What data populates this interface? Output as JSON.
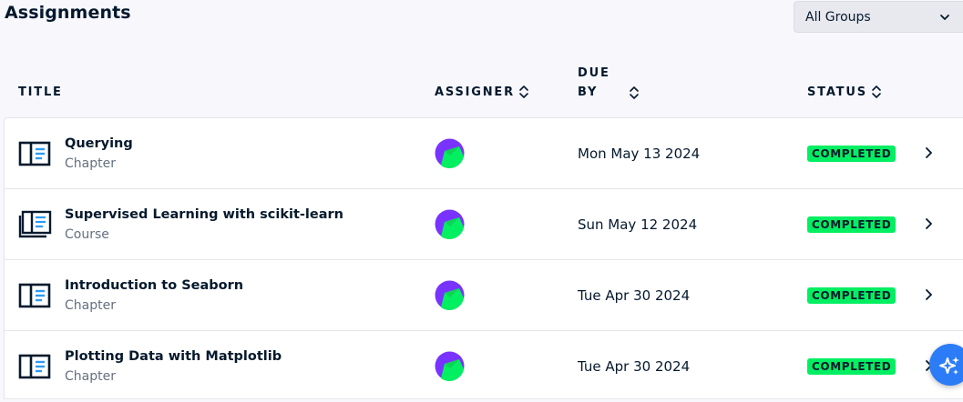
{
  "header": {
    "title": "Assignments",
    "group_filter": "All Groups"
  },
  "columns": {
    "title": "TITLE",
    "assigner": "ASSIGNER",
    "due_line1": "DUE",
    "due_line2": "BY",
    "status": "STATUS"
  },
  "rows": [
    {
      "title": "Querying",
      "type": "Chapter",
      "due": "Mon May 13 2024",
      "status": "COMPLETED",
      "icon": "chapter-icon"
    },
    {
      "title": "Supervised Learning with scikit-learn",
      "type": "Course",
      "due": "Sun May 12 2024",
      "status": "COMPLETED",
      "icon": "course-icon"
    },
    {
      "title": "Introduction to Seaborn",
      "type": "Chapter",
      "due": "Tue Apr 30 2024",
      "status": "COMPLETED",
      "icon": "chapter-icon"
    },
    {
      "title": "Plotting Data with Matplotlib",
      "type": "Chapter",
      "due": "Tue Apr 30 2024",
      "status": "COMPLETED",
      "icon": "chapter-icon"
    }
  ],
  "colors": {
    "status_badge": "#03ef62",
    "avatar_purple": "#7933ff",
    "avatar_green": "#03ef62",
    "ai_button": "#2b7cf6"
  }
}
